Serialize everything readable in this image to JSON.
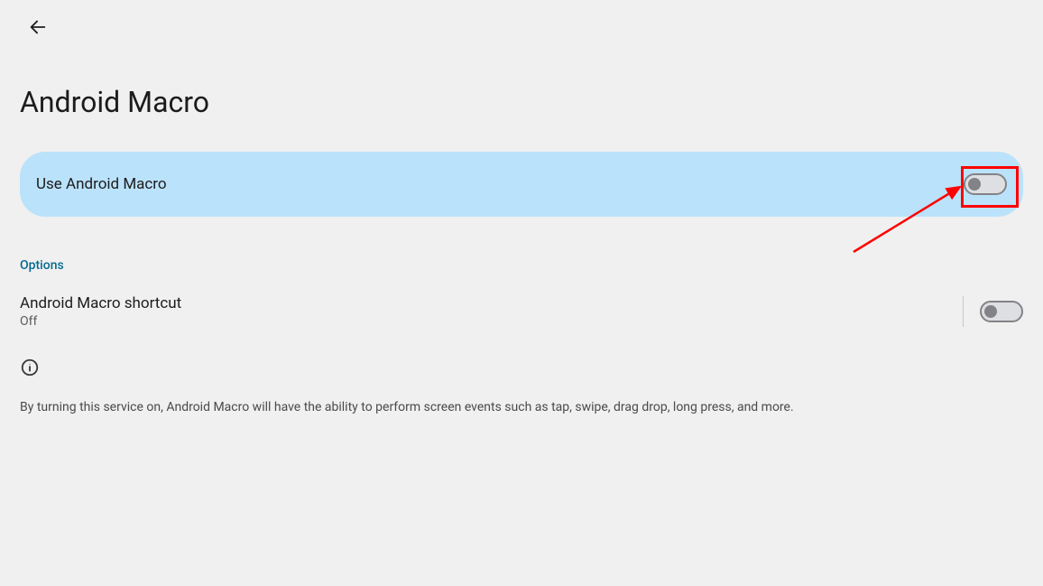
{
  "header": {
    "title": "Android Macro"
  },
  "primary": {
    "label": "Use Android Macro",
    "enabled": false
  },
  "sections": {
    "options_label": "Options"
  },
  "shortcut": {
    "title": "Android Macro shortcut",
    "status": "Off",
    "enabled": false
  },
  "description": "By turning this service on, Android Macro will have the ability to perform screen events such as tap, swipe, drag drop, long press, and more."
}
